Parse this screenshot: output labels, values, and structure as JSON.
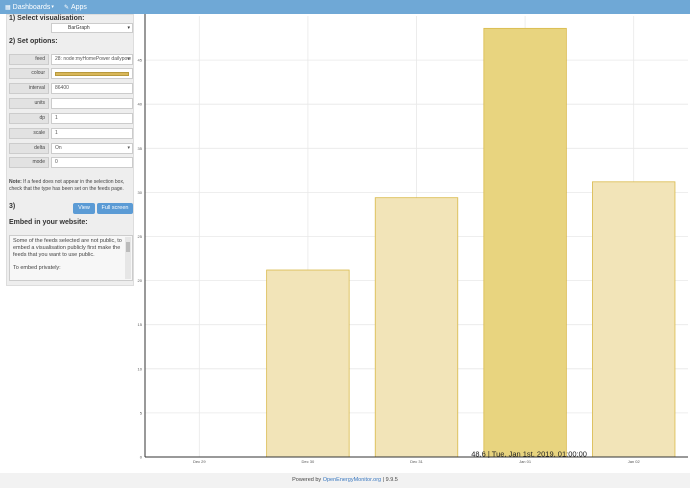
{
  "topbar": {
    "dashboards": "Dashboards",
    "apps": "Apps"
  },
  "sidebar": {
    "select_heading": "1) Select visualisation:",
    "visualisation": "BarGraph",
    "options_heading": "2) Set options:",
    "options": [
      {
        "label": "feed",
        "value": "28: node:myHomePower dailypow",
        "select": true
      },
      {
        "label": "colour",
        "value": "",
        "swatch": true
      },
      {
        "label": "interval",
        "value": "86400"
      },
      {
        "label": "units",
        "value": ""
      },
      {
        "label": "dp",
        "value": "1"
      },
      {
        "label": "scale",
        "value": "1"
      },
      {
        "label": "delta",
        "value": "On",
        "select": true
      },
      {
        "label": "mode",
        "value": "0"
      }
    ],
    "note_bold": "Note:",
    "note": " If a feed does not appear in the selection box, check that the type has been set on the feeds page.",
    "step3": "3)",
    "view_button": "View",
    "fullscreen_button": "Full screen",
    "embed_heading": "Embed in your website:",
    "embed_text": "Some of the feeds selected are not public, to embed a visualisation publicly first make the feeds that you want to use public.",
    "embed_text2": "To embed privately:"
  },
  "chart_data": {
    "type": "bar",
    "categories": [
      "Dec 29",
      "Dec 30",
      "Dec 31",
      "Jan 01",
      "Jan 02"
    ],
    "values": [
      0,
      21.2,
      29.4,
      48.6,
      31.2
    ],
    "ylim": [
      0,
      50
    ],
    "yticks": [
      0,
      5,
      10,
      15,
      20,
      25,
      30,
      35,
      40,
      45
    ],
    "highlight_index": 3,
    "tooltip": "48.6 | Tue, Jan 1st, 2019, 01:00:00",
    "colors": {
      "bar": "#f2e4b8",
      "bar_highlight": "#e8d47f",
      "bar_border": "#d9b94a"
    },
    "grid": true
  },
  "footer": {
    "prefix": "Powered by ",
    "link": "OpenEnergyMonitor.org",
    "version": " | 9.9.5"
  }
}
